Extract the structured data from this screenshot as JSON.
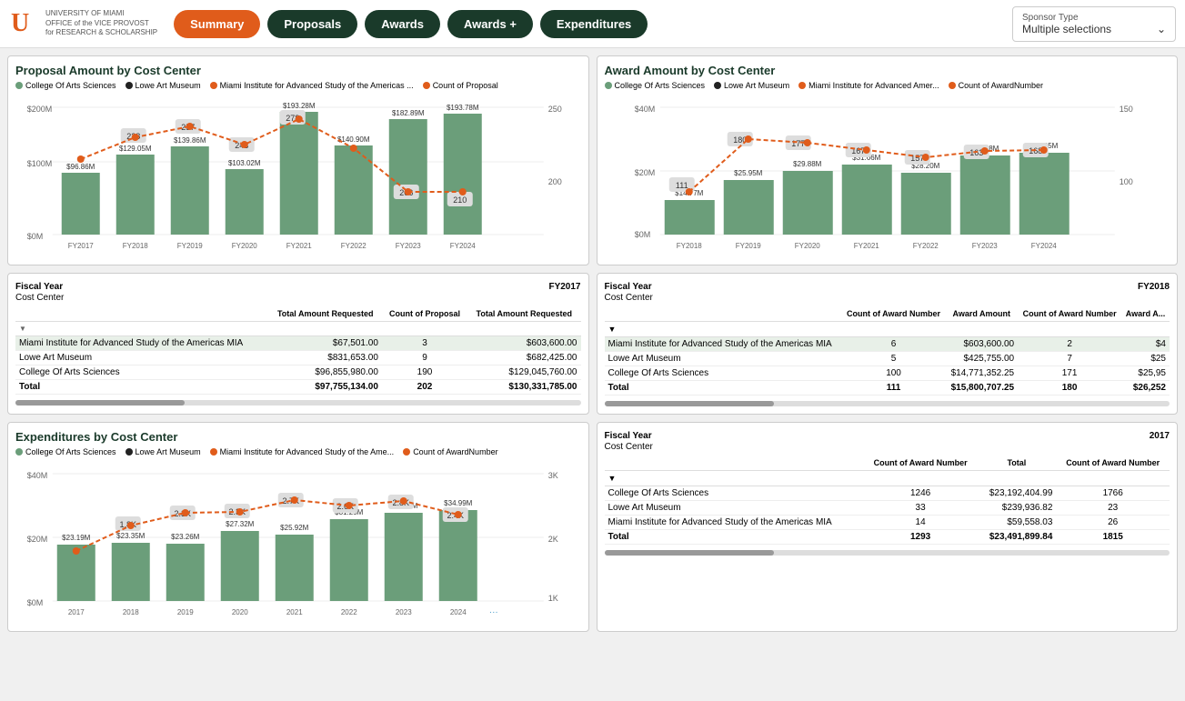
{
  "header": {
    "logo_line1": "UNIVERSITY OF MIAMI",
    "logo_line2": "OFFICE of the VICE PROVOST",
    "logo_line3": "for RESEARCH & SCHOLARSHIP",
    "nav": [
      "Summary",
      "Proposals",
      "Awards",
      "Awards +",
      "Expenditures"
    ],
    "active_nav": "Summary",
    "sponsor_filter_label": "Sponsor Type",
    "sponsor_filter_value": "Multiple selections"
  },
  "proposal_chart": {
    "title": "Proposal Amount by Cost Center",
    "legend": [
      "College Of Arts  Sciences",
      "Lowe Art Museum",
      "Miami Institute for Advanced Study of the Americas ...",
      "Count of Proposal"
    ],
    "bars": [
      {
        "year": "FY2017",
        "amount": "$96.86M",
        "count": null
      },
      {
        "year": "FY2018",
        "amount": "$129.05M",
        "count": 228
      },
      {
        "year": "FY2019",
        "amount": "$139.86M",
        "count": 257
      },
      {
        "year": "FY2020",
        "amount": "$103.02M",
        "count": 243
      },
      {
        "year": "FY2021",
        "amount": "$193.28M",
        "count": 278
      },
      {
        "year": "FY2022",
        "amount": "$140.90M",
        "count": null
      },
      {
        "year": "FY2023",
        "amount": "$182.89M",
        "count": 206
      },
      {
        "year": "FY2024",
        "amount": "$193.78M",
        "count": 210
      }
    ]
  },
  "award_chart": {
    "title": "Award Amount by Cost Center",
    "legend": [
      "College Of Arts  Sciences",
      "Lowe Art Museum",
      "Miami Institute for Advanced Amer...",
      "Count of AwardNumber"
    ],
    "bars": [
      {
        "year": "FY2018",
        "amount": "$14.77M",
        "count": 111
      },
      {
        "year": "FY2019",
        "amount": "$25.95M",
        "count": 180
      },
      {
        "year": "FY2020",
        "amount": "$29.88M",
        "count": 177
      },
      {
        "year": "FY2021",
        "amount": "$31.66M",
        "count": 167
      },
      {
        "year": "FY2022",
        "amount": "$28.20M",
        "count": 157
      },
      {
        "year": "FY2023",
        "amount": "$36.18M",
        "count": 163
      },
      {
        "year": "FY2024",
        "amount": "$36.85M",
        "count": 168
      }
    ]
  },
  "proposal_table": {
    "fiscal_year_label": "Fiscal Year",
    "cost_center_label": "Cost Center",
    "fy_col": "FY2017",
    "cols": [
      "Total Amount Requested",
      "Count of Proposal",
      "Total Amount Requested"
    ],
    "rows": [
      {
        "name": "Miami Institute for Advanced Study of the Americas MIA",
        "val1": "$67,501.00",
        "val2": "3",
        "val3": "$603,600.00"
      },
      {
        "name": "Lowe Art Museum",
        "val1": "$831,653.00",
        "val2": "9",
        "val3": "$682,425.00"
      },
      {
        "name": "College Of Arts  Sciences",
        "val1": "$96,855,980.00",
        "val2": "190",
        "val3": "$129,045,760.00"
      },
      {
        "name": "Total",
        "val1": "$97,755,134.00",
        "val2": "202",
        "val3": "$130,331,785.00",
        "bold": true
      }
    ]
  },
  "award_table": {
    "fiscal_year_label": "Fiscal Year",
    "cost_center_label": "Cost Center",
    "fy_col": "FY2018",
    "cols": [
      "Count of Award Number",
      "Award Amount",
      "Count of Award Number",
      "Award A..."
    ],
    "rows": [
      {
        "name": "Miami Institute for Advanced Study of the Americas MIA",
        "val1": "6",
        "val2": "$603,600.00",
        "val3": "2",
        "val4": "$4"
      },
      {
        "name": "Lowe Art Museum",
        "val1": "5",
        "val2": "$425,755.00",
        "val3": "7",
        "val4": "$25"
      },
      {
        "name": "College Of Arts  Sciences",
        "val1": "100",
        "val2": "$14,771,352.25",
        "val3": "171",
        "val4": "$25,95"
      },
      {
        "name": "Total",
        "val1": "111",
        "val2": "$15,800,707.25",
        "val3": "180",
        "val4": "$26,252",
        "bold": true
      }
    ]
  },
  "expenditures_chart": {
    "title": "Expenditures by Cost Center",
    "legend": [
      "College Of Arts  Sciences",
      "Lowe Art Museum",
      "Miami Institute for Advanced Study of the Ame...",
      "Count of AwardNumber"
    ],
    "bars": [
      {
        "year": "2017",
        "amount": "$23.19M",
        "count": null
      },
      {
        "year": "2018",
        "amount": "$23.35M",
        "count": "1.8K"
      },
      {
        "year": "2019",
        "amount": "$23.26M",
        "count": "2.3K"
      },
      {
        "year": "2020",
        "amount": "$27.32M",
        "count": "2.3K"
      },
      {
        "year": "2021",
        "amount": "$25.92M",
        "count": "2.7K"
      },
      {
        "year": "2022",
        "amount": "$31.25M",
        "count": "2.6K"
      },
      {
        "year": "2023",
        "amount": "$33.98M",
        "count": "2.8K"
      },
      {
        "year": "2024",
        "amount": "$34.99M",
        "count": "2.4K"
      }
    ]
  },
  "expenditures_table": {
    "fiscal_year_label": "Fiscal Year",
    "cost_center_label": "Cost Center",
    "fy_col": "2017",
    "cols": [
      "Count of Award Number",
      "Total",
      "Count of Award Number"
    ],
    "rows": [
      {
        "name": "College Of Arts  Sciences",
        "val1": "1246",
        "val2": "$23,192,404.99",
        "val3": "1766"
      },
      {
        "name": "Lowe Art Museum",
        "val1": "33",
        "val2": "$239,936.82",
        "val3": "23"
      },
      {
        "name": "Miami Institute for Advanced Study of the Americas MIA",
        "val1": "14",
        "val2": "$59,558.03",
        "val3": "26"
      },
      {
        "name": "Total",
        "val1": "1293",
        "val2": "$23,491,899.84",
        "val3": "1815",
        "bold": true
      }
    ]
  }
}
